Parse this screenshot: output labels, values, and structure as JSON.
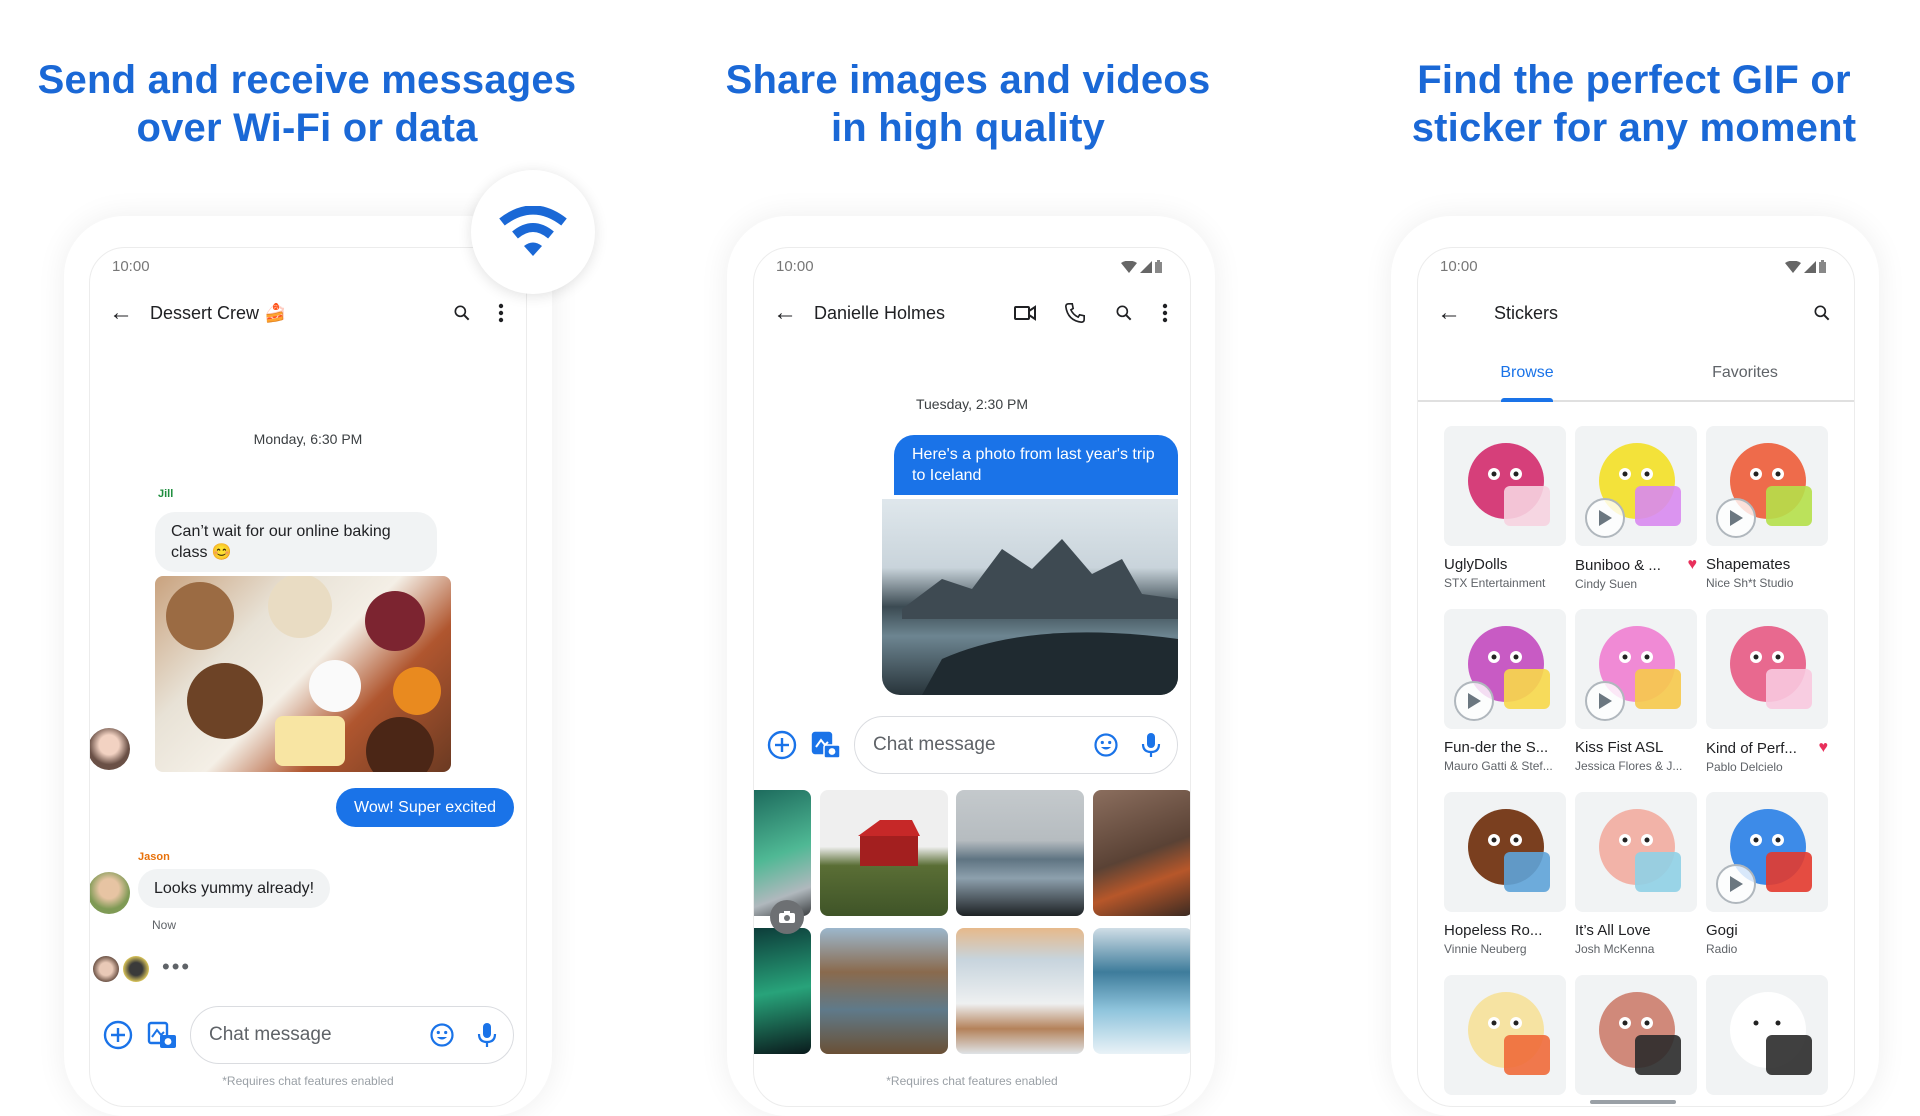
{
  "headings": [
    {
      "line1": "Send and receive messages",
      "line2": "over Wi-Fi or data"
    },
    {
      "line1": "Share images and videos",
      "line2": "in high quality"
    },
    {
      "line1": "Find the perfect GIF or",
      "line2": "sticker for any moment"
    }
  ],
  "colors": {
    "accent": "#1a73e8",
    "heading": "#1a68d6",
    "bubble_in": "#f1f3f4",
    "heart": "#e8305b",
    "jill": "#1e8e3e",
    "jason": "#e8710a"
  },
  "screen1": {
    "status_time": "10:00",
    "title": "Dessert Crew",
    "title_emoji": "🍰",
    "icons": [
      "back-arrow-icon",
      "search-icon",
      "more-vert-icon"
    ],
    "datestamp": "Monday, 6:30 PM",
    "messages": [
      {
        "sender": "Jill",
        "text": "Can’t wait for our online baking class 😊"
      },
      {
        "sender": "me",
        "text": "Wow! Super excited"
      },
      {
        "sender": "Jason",
        "text": "Looks yummy already!",
        "time": "Now"
      }
    ],
    "typing_indicator": "•••",
    "compose_placeholder": "Chat message",
    "footnote": "*Requires chat features enabled",
    "feature_badge_icon": "wifi-icon"
  },
  "screen2": {
    "status_time": "10:00",
    "title": "Danielle Holmes",
    "icons": [
      "back-arrow-icon",
      "video-call-icon",
      "phone-icon",
      "search-icon",
      "more-vert-icon"
    ],
    "datestamp": "Tuesday, 2:30 PM",
    "message_out": "Here's a photo from last year's trip to Iceland",
    "compose_placeholder": "Chat message",
    "gallery_photos": [
      "aurora",
      "red-house",
      "coast",
      "hikers",
      "aurora-2",
      "kirkjufell",
      "horses",
      "waterfall"
    ],
    "footnote": "*Requires chat features enabled"
  },
  "screen3": {
    "status_time": "10:00",
    "title": "Stickers",
    "tabs": [
      {
        "label": "Browse",
        "active": true
      },
      {
        "label": "Favorites",
        "active": false
      }
    ],
    "stickers": [
      {
        "name": "UglyDolls",
        "author": "STX Entertainment",
        "animated": false,
        "favorite": false
      },
      {
        "name": "Buniboo & ...",
        "author": "Cindy Suen",
        "animated": true,
        "favorite": true
      },
      {
        "name": "Shapemates",
        "author": "Nice Sh*t Studio",
        "animated": true,
        "favorite": false
      },
      {
        "name": "Fun-der the S...",
        "author": "Mauro Gatti & Stef...",
        "animated": true,
        "favorite": false
      },
      {
        "name": "Kiss Fist ASL",
        "author": "Jessica Flores & J...",
        "animated": true,
        "favorite": false
      },
      {
        "name": "Kind of Perf...",
        "author": "Pablo Delcielo",
        "animated": false,
        "favorite": true
      },
      {
        "name": "Hopeless Ro...",
        "author": "Vinnie Neuberg",
        "animated": false,
        "favorite": false
      },
      {
        "name": "It’s All Love",
        "author": "Josh McKenna",
        "animated": false,
        "favorite": false
      },
      {
        "name": "Gogi",
        "author": "Radio",
        "animated": true,
        "favorite": false
      },
      {
        "name": "",
        "author": "",
        "animated": false,
        "favorite": false
      },
      {
        "name": "",
        "author": "",
        "animated": false,
        "favorite": false
      },
      {
        "name": "",
        "author": "",
        "animated": false,
        "favorite": false
      }
    ]
  }
}
